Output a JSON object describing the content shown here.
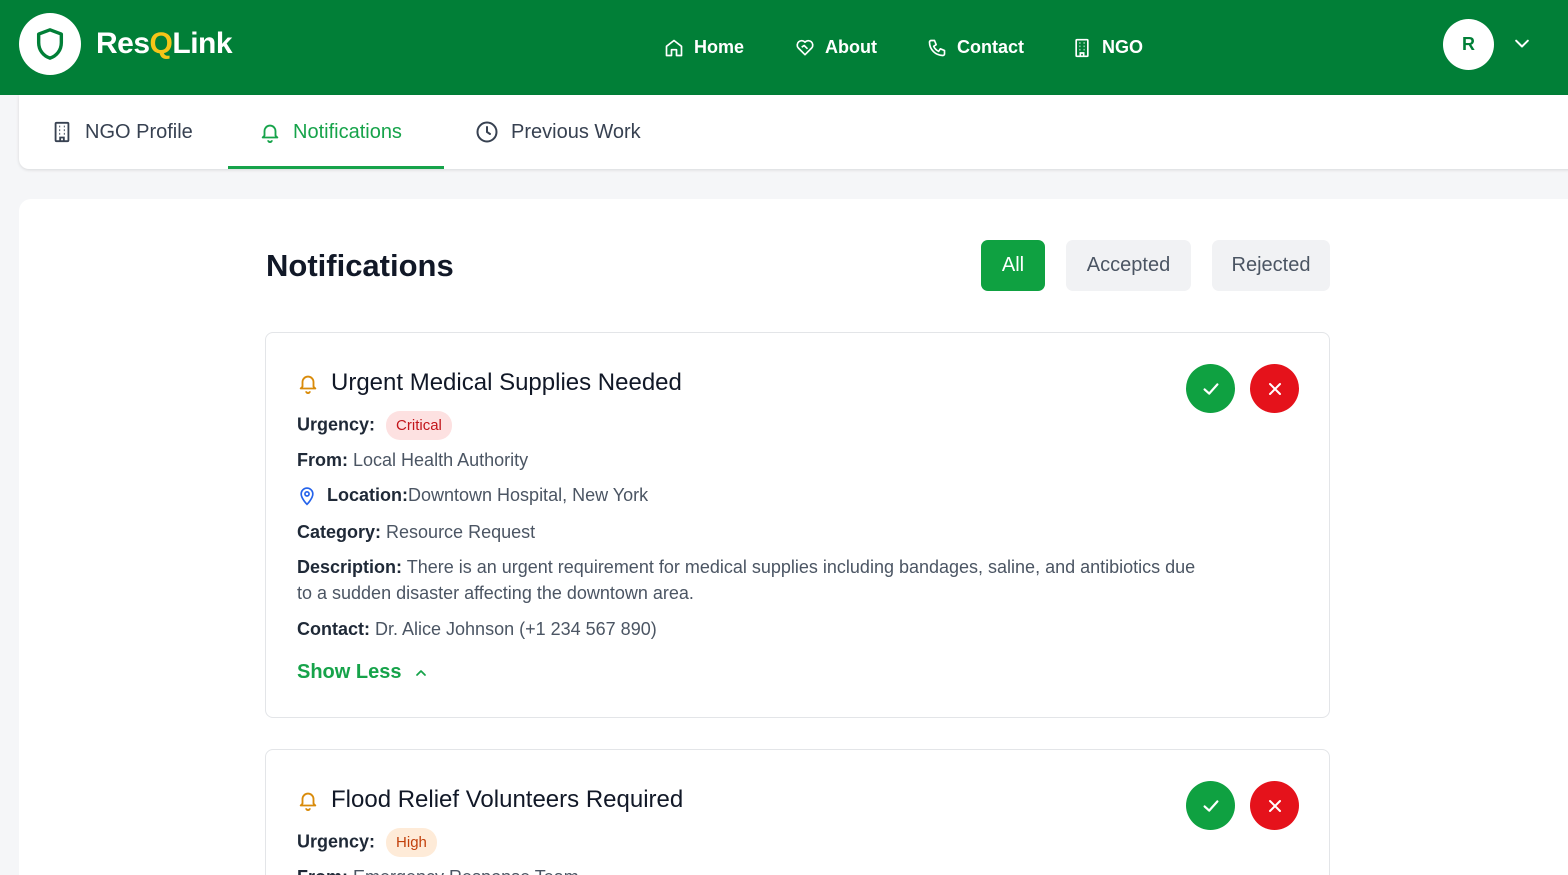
{
  "app": {
    "brand_prefix": "Res",
    "brand_q": "Q",
    "brand_suffix": "Link",
    "avatar_initial": "R"
  },
  "nav": {
    "home": "Home",
    "about": "About",
    "contact": "Contact",
    "ngo": "NGO"
  },
  "tabs": {
    "profile": "NGO Profile",
    "notifications": "Notifications",
    "previous": "Previous Work"
  },
  "page": {
    "title": "Notifications"
  },
  "filters": {
    "all": "All",
    "accepted": "Accepted",
    "rejected": "Rejected",
    "selected": "All"
  },
  "labels": {
    "urgency": "Urgency:",
    "from": "From:",
    "location": "Location:",
    "category": "Category:",
    "description": "Description:",
    "contact": "Contact:",
    "show_less": "Show Less"
  },
  "notifications": [
    {
      "title": "Urgent Medical Supplies Needed",
      "urgency": "Critical",
      "from": "Local Health Authority",
      "location": "Downtown Hospital, New York",
      "category": "Resource Request",
      "description": "There is an urgent requirement for medical supplies including bandages, saline, and antibiotics due to a sudden disaster affecting the downtown area.",
      "contact": "Dr. Alice Johnson (+1 234 567 890)"
    },
    {
      "title": "Flood Relief Volunteers Required",
      "urgency": "High",
      "from": "Emergency Response Team"
    }
  ],
  "colors": {
    "brand_green": "#017f37",
    "accent_green": "#16a34a",
    "accept_green": "#0fa141",
    "reject_red": "#e5121b",
    "brand_yellow": "#f5c518"
  }
}
